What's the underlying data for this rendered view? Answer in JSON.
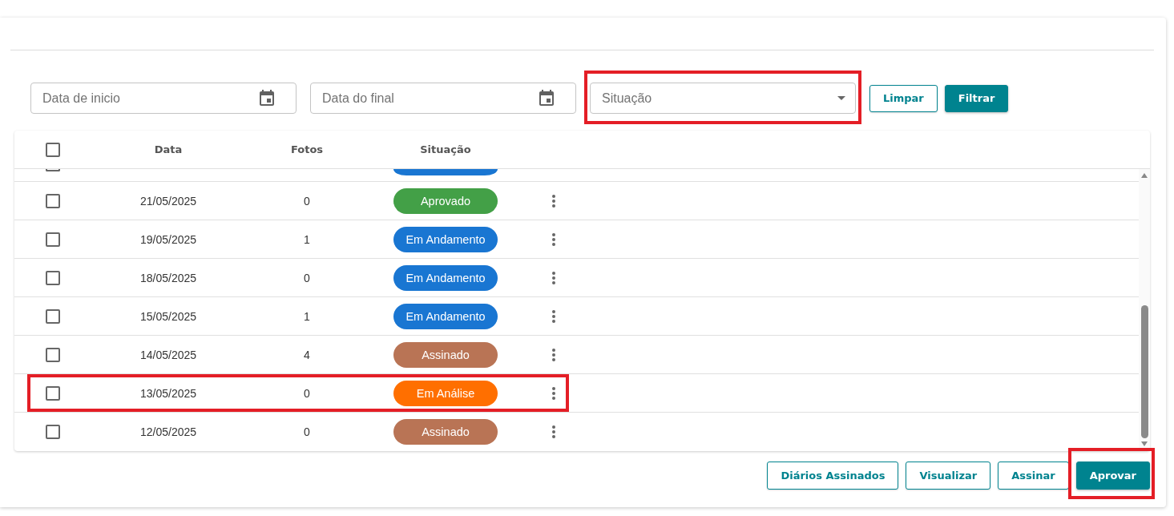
{
  "filters": [
    {
      "kind": "date",
      "placeholder": "Data de inicio",
      "highlighted": false
    },
    {
      "kind": "date",
      "placeholder": "Data do final",
      "highlighted": false
    },
    {
      "kind": "select",
      "placeholder": "Situação",
      "highlighted": true
    }
  ],
  "filter_buttons": [
    {
      "label": "Limpar",
      "kind": "outlined"
    },
    {
      "label": "Filtrar",
      "kind": "filled"
    }
  ],
  "table": {
    "select_all_checked": false,
    "columns": [
      "Data",
      "Fotos",
      "Situação"
    ],
    "partial_row": {
      "color": "#1976d2",
      "checked": false
    },
    "rows": [
      {
        "date": "21/05/2025",
        "photos": "0",
        "status": "Aprovado",
        "color": "#43a047",
        "checked": false,
        "highlighted": false
      },
      {
        "date": "19/05/2025",
        "photos": "1",
        "status": "Em Andamento",
        "color": "#1976d2",
        "checked": false,
        "highlighted": false
      },
      {
        "date": "18/05/2025",
        "photos": "0",
        "status": "Em Andamento",
        "color": "#1976d2",
        "checked": false,
        "highlighted": false
      },
      {
        "date": "15/05/2025",
        "photos": "1",
        "status": "Em Andamento",
        "color": "#1976d2",
        "checked": false,
        "highlighted": false
      },
      {
        "date": "14/05/2025",
        "photos": "4",
        "status": "Assinado",
        "color": "#b97455",
        "checked": false,
        "highlighted": false
      },
      {
        "date": "13/05/2025",
        "photos": "0",
        "status": "Em Análise",
        "color": "#ff6f00",
        "checked": false,
        "highlighted": true
      },
      {
        "date": "12/05/2025",
        "photos": "0",
        "status": "Assinado",
        "color": "#b97455",
        "checked": false,
        "highlighted": false
      }
    ]
  },
  "actions": [
    {
      "label": "Diários Assinados",
      "kind": "outlined",
      "highlighted": false
    },
    {
      "label": "Visualizar",
      "kind": "outlined",
      "highlighted": false
    },
    {
      "label": "Assinar",
      "kind": "outlined",
      "highlighted": false
    },
    {
      "label": "Aprovar",
      "kind": "filled",
      "highlighted": true
    }
  ]
}
